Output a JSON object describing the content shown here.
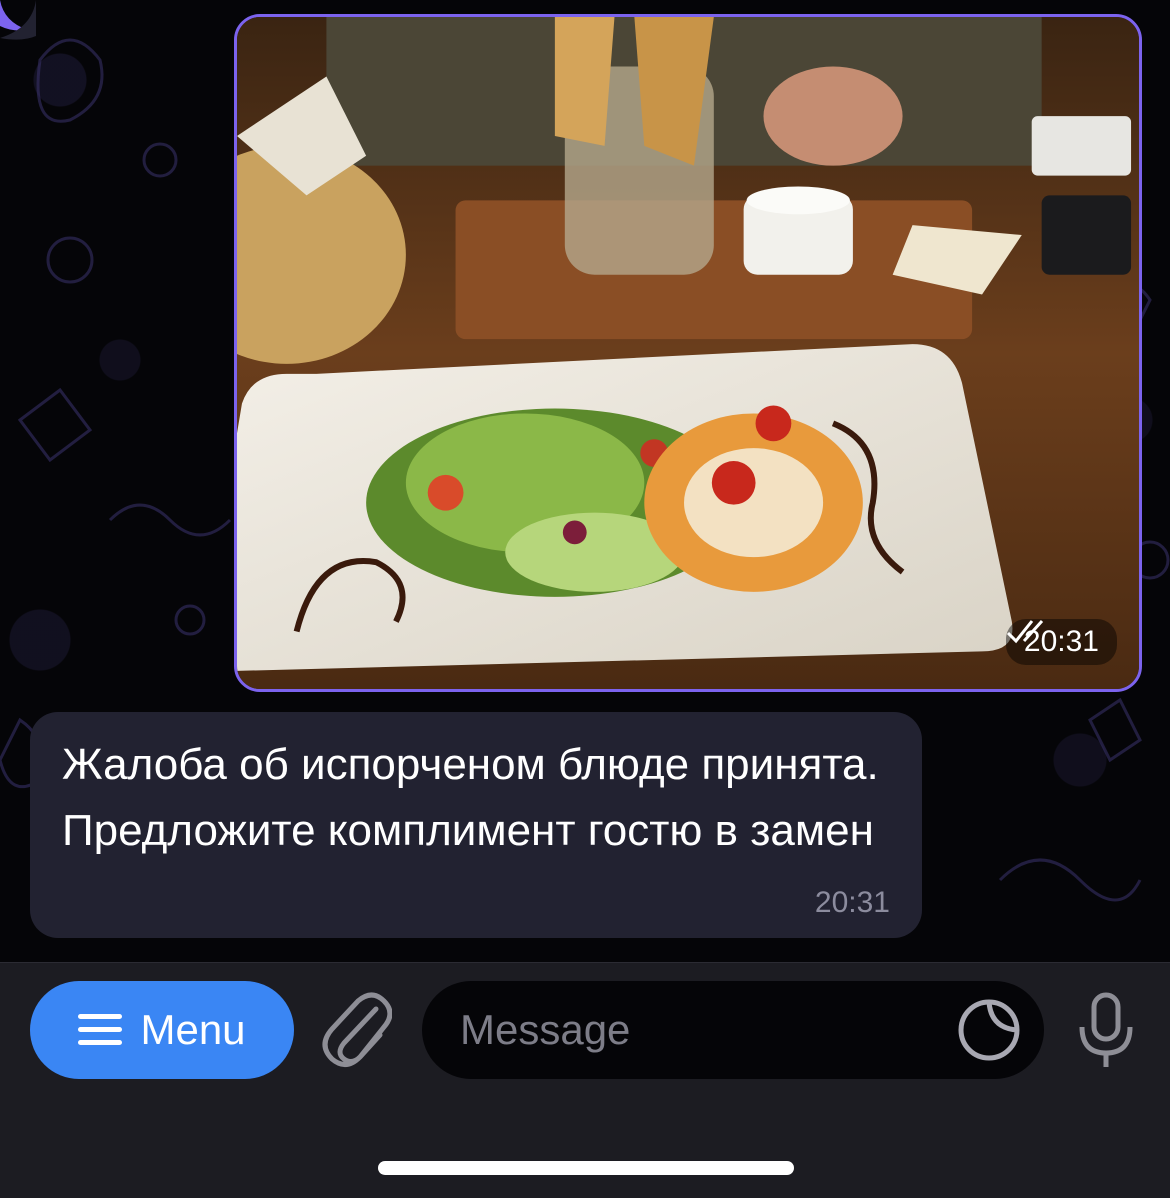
{
  "chat": {
    "photo_message": {
      "image_name": "food-photo-salad-plate",
      "time": "20:31",
      "status_icon": "double-check-icon"
    },
    "text_message": {
      "text": "Жалоба об испорченом блюде принята. Предложите комплимент гостю в замен",
      "time": "20:31"
    }
  },
  "input_bar": {
    "menu_label": "Menu",
    "menu_icon": "hamburger-icon",
    "attach_icon": "paperclip-icon",
    "message_placeholder": "Message",
    "sticker_icon": "sticker-icon",
    "mic_icon": "microphone-icon"
  },
  "colors": {
    "outgoing_border": "#7c63ee",
    "incoming_bubble": "#222231",
    "menu_button": "#3a86f4",
    "input_bar": "#1c1c22"
  }
}
